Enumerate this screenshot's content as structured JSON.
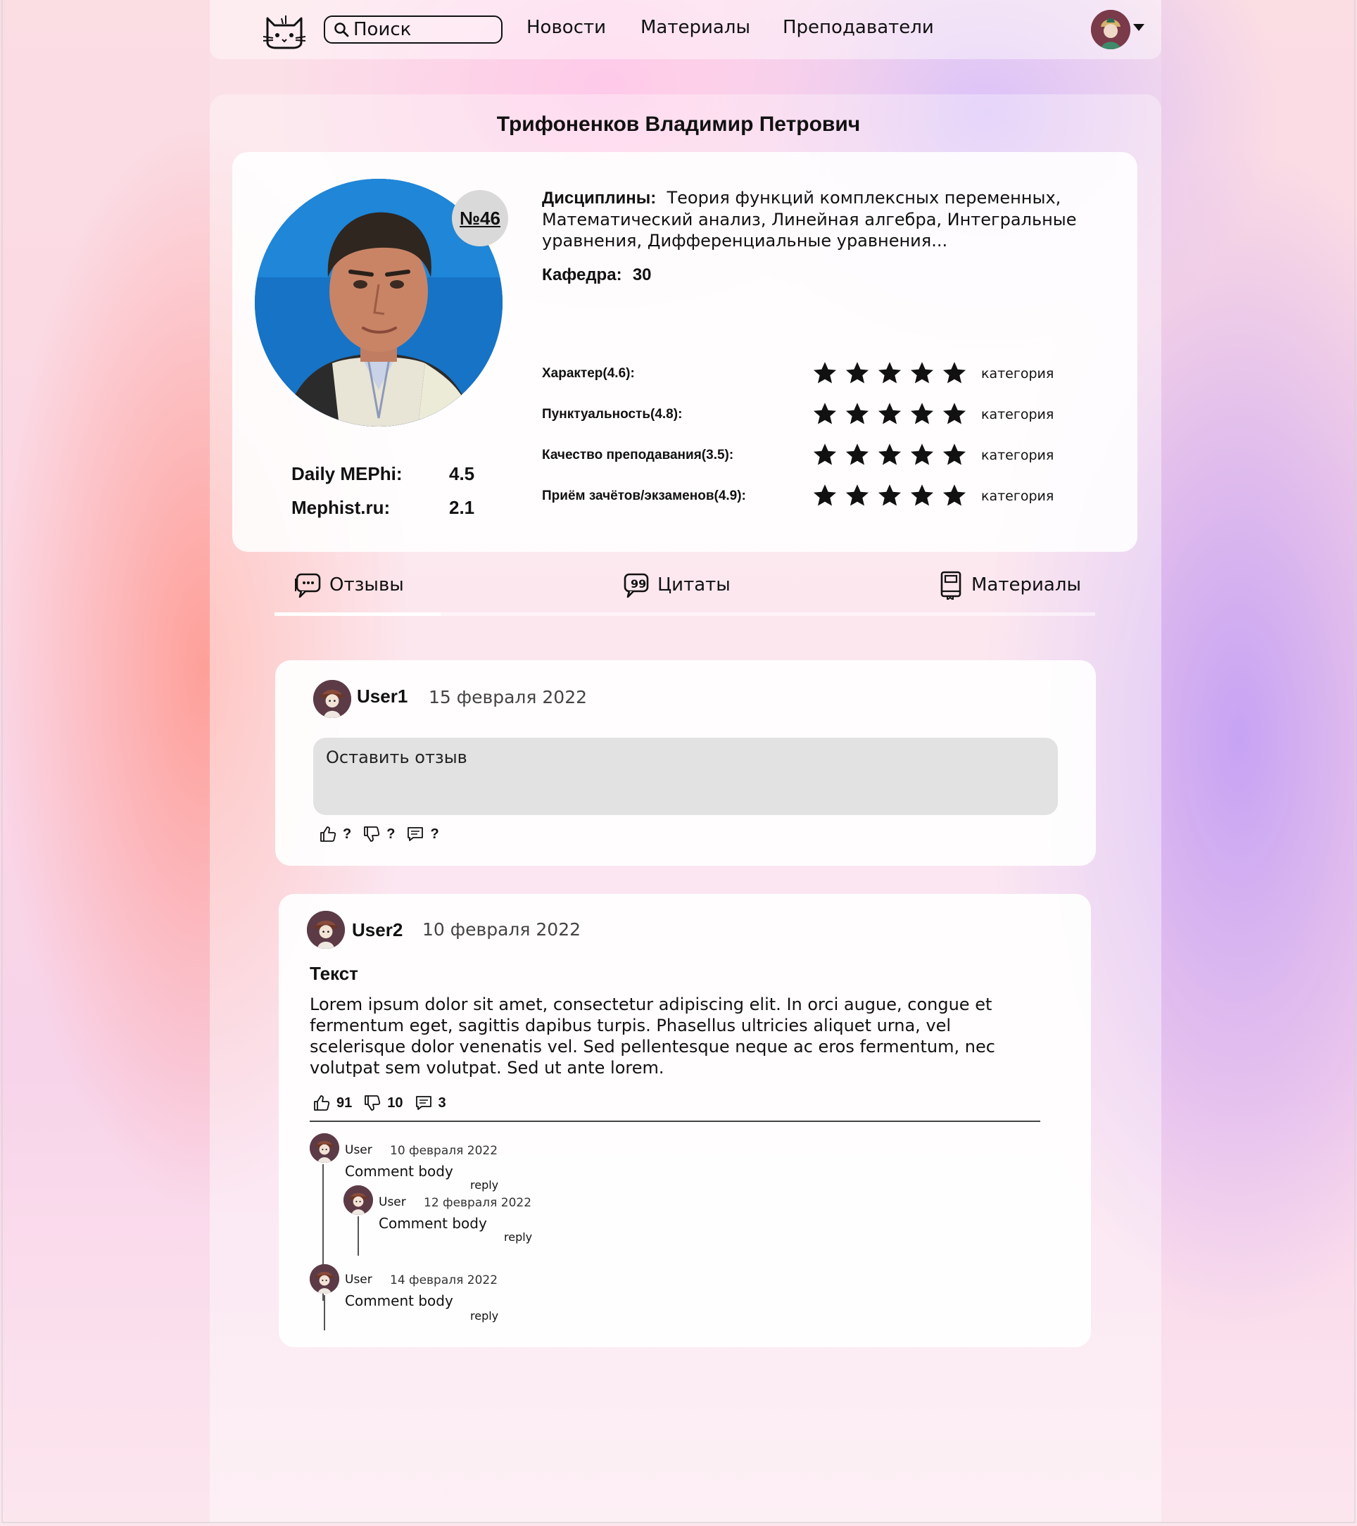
{
  "navbar": {
    "search_placeholder": "Поиск",
    "links": [
      "Новости",
      "Материалы",
      "Преподаватели"
    ]
  },
  "teacher": {
    "name": "Трифоненков Владимир Петрович",
    "rank": "№46",
    "disciplines_label": "Дисциплины:",
    "disciplines": "Теория функций комплексных переменных, Математический анализ, Линейная алгебра, Интегральные уравнения, Дифференциальные уравнения...",
    "department_label": "Кафедра:",
    "department": "30",
    "external_ratings": [
      {
        "label": "Daily MEPhi:",
        "value": "4.5"
      },
      {
        "label": "Mephist.ru:",
        "value": "2.1"
      }
    ],
    "criteria": [
      {
        "label": "Характер(4.6):",
        "stars": 5,
        "category": "категория"
      },
      {
        "label": "Пунктуальность(4.8):",
        "stars": 5,
        "category": "категория"
      },
      {
        "label": "Качество преподавания(3.5):",
        "stars": 5,
        "category": "категория"
      },
      {
        "label": "Приём зачётов/экзаменов(4.9):",
        "stars": 5,
        "category": "категория"
      }
    ]
  },
  "tabs": [
    {
      "label": "Отзывы",
      "active": true,
      "icon": "chat-bubble-icon"
    },
    {
      "label": "Цитаты",
      "active": false,
      "icon": "quote-bubble-icon"
    },
    {
      "label": "Материалы",
      "active": false,
      "icon": "book-icon"
    }
  ],
  "new_review": {
    "user": "User1",
    "date": "15 февраля 2022",
    "placeholder": "Оставить отзыв",
    "likes": "?",
    "dislikes": "?",
    "comments": "?"
  },
  "review": {
    "user": "User2",
    "date": "10 февраля 2022",
    "heading": "Текст",
    "body": "Lorem ipsum dolor sit amet, consectetur adipiscing elit. In orci augue, congue et fermentum eget, sagittis dapibus turpis. Phasellus ultricies aliquet urna, vel scelerisque dolor venenatis vel. Sed pellentesque neque ac eros fermentum, nec volutpat sem volutpat. Sed ut ante lorem.",
    "likes": "91",
    "dislikes": "10",
    "comments": "3",
    "thread": [
      {
        "user": "User",
        "date": "10 февраля 2022",
        "body": "Comment body",
        "reply": "reply"
      },
      {
        "user": "User",
        "date": "12 февраля 2022",
        "body": "Comment body",
        "reply": "reply"
      },
      {
        "user": "User",
        "date": "14 февраля 2022",
        "body": "Comment body",
        "reply": "reply"
      }
    ]
  },
  "colors": {
    "accent_pink": "#fbd7e4",
    "accent_violet": "#c4a0f5",
    "input_gray": "#e3e2e3"
  }
}
